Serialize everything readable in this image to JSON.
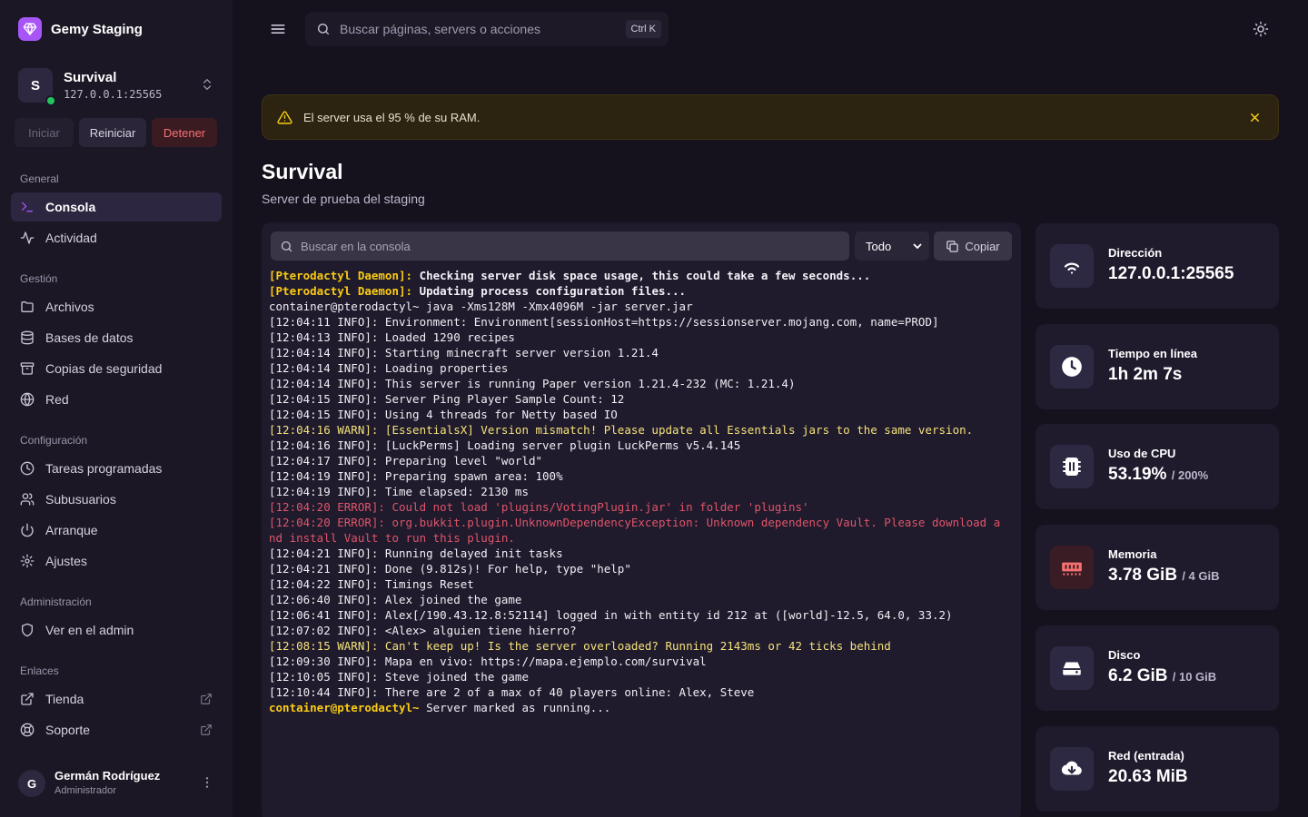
{
  "brand": {
    "name": "Gemy Staging"
  },
  "server": {
    "initial": "S",
    "name": "Survival",
    "address": "127.0.0.1:25565"
  },
  "power": {
    "start": "Iniciar",
    "restart": "Reiniciar",
    "stop": "Detener"
  },
  "nav": {
    "general": {
      "title": "General",
      "items": [
        "Consola",
        "Actividad"
      ]
    },
    "management": {
      "title": "Gestión",
      "items": [
        "Archivos",
        "Bases de datos",
        "Copias de seguridad",
        "Red"
      ]
    },
    "config": {
      "title": "Configuración",
      "items": [
        "Tareas programadas",
        "Subusuarios",
        "Arranque",
        "Ajustes"
      ]
    },
    "admin": {
      "title": "Administración",
      "items": [
        "Ver en el admin"
      ]
    },
    "links": {
      "title": "Enlaces",
      "items": [
        "Tienda",
        "Soporte"
      ]
    }
  },
  "user": {
    "initial": "G",
    "name": "Germán Rodríguez",
    "role": "Administrador"
  },
  "topbar": {
    "search_placeholder": "Buscar páginas, servers o acciones",
    "shortcut": "Ctrl K"
  },
  "alert": {
    "message": "El server usa el 95 % de su RAM."
  },
  "page": {
    "title": "Survival",
    "subtitle": "Server de prueba del staging"
  },
  "console": {
    "search_placeholder": "Buscar en la consola",
    "filter": "Todo",
    "copy": "Copiar",
    "lines": [
      {
        "t": "daemon",
        "a": "[Pterodactyl Daemon]:",
        "b": " Checking server disk space usage, this could take a few seconds..."
      },
      {
        "t": "daemon",
        "a": "[Pterodactyl Daemon]:",
        "b": " Updating process configuration files..."
      },
      {
        "t": "info",
        "text": "container@pterodactyl~ java -Xms128M -Xmx4096M -jar server.jar"
      },
      {
        "t": "info",
        "text": "[12:04:11 INFO]: Environment: Environment[sessionHost=https://sessionserver.mojang.com, name=PROD]"
      },
      {
        "t": "info",
        "text": "[12:04:13 INFO]: Loaded 1290 recipes"
      },
      {
        "t": "info",
        "text": "[12:04:14 INFO]: Starting minecraft server version 1.21.4"
      },
      {
        "t": "info",
        "text": "[12:04:14 INFO]: Loading properties"
      },
      {
        "t": "info",
        "text": "[12:04:14 INFO]: This server is running Paper version 1.21.4-232 (MC: 1.21.4)"
      },
      {
        "t": "info",
        "text": "[12:04:15 INFO]: Server Ping Player Sample Count: 12"
      },
      {
        "t": "info",
        "text": "[12:04:15 INFO]: Using 4 threads for Netty based IO"
      },
      {
        "t": "warn",
        "text": "[12:04:16 WARN]: [EssentialsX] Version mismatch! Please update all Essentials jars to the same version."
      },
      {
        "t": "info",
        "text": "[12:04:16 INFO]: [LuckPerms] Loading server plugin LuckPerms v5.4.145"
      },
      {
        "t": "info",
        "text": "[12:04:17 INFO]: Preparing level \"world\""
      },
      {
        "t": "info",
        "text": "[12:04:19 INFO]: Preparing spawn area: 100%"
      },
      {
        "t": "info",
        "text": "[12:04:19 INFO]: Time elapsed: 2130 ms"
      },
      {
        "t": "error",
        "text": "[12:04:20 ERROR]: Could not load 'plugins/VotingPlugin.jar' in folder 'plugins'"
      },
      {
        "t": "error",
        "text": "[12:04:20 ERROR]: org.bukkit.plugin.UnknownDependencyException: Unknown dependency Vault. Please download and install Vault to run this plugin."
      },
      {
        "t": "info",
        "text": "[12:04:21 INFO]: Running delayed init tasks"
      },
      {
        "t": "info",
        "text": "[12:04:21 INFO]: Done (9.812s)! For help, type \"help\""
      },
      {
        "t": "info",
        "text": "[12:04:22 INFO]: Timings Reset"
      },
      {
        "t": "info",
        "text": "[12:06:40 INFO]: Alex joined the game"
      },
      {
        "t": "info",
        "text": "[12:06:41 INFO]: Alex[/190.43.12.8:52114] logged in with entity id 212 at ([world]-12.5, 64.0, 33.2)"
      },
      {
        "t": "info",
        "text": "[12:07:02 INFO]: <Alex> alguien tiene hierro?"
      },
      {
        "t": "warn",
        "text": "[12:08:15 WARN]: Can't keep up! Is the server overloaded? Running 2143ms or 42 ticks behind"
      },
      {
        "t": "info",
        "text": "[12:09:30 INFO]: Mapa en vivo: https://mapa.ejemplo.com/survival"
      },
      {
        "t": "info",
        "text": "[12:10:05 INFO]: Steve joined the game"
      },
      {
        "t": "info",
        "text": "[12:10:44 INFO]: There are 2 of a max of 40 players online: Alex, Steve"
      },
      {
        "t": "prompt",
        "a": "container@pterodactyl~",
        "b": " Server marked as running..."
      }
    ]
  },
  "stats": [
    {
      "icon": "wifi-icon",
      "label": "Dirección",
      "value": "127.0.0.1:25565",
      "max": ""
    },
    {
      "icon": "clock-icon",
      "label": "Tiempo en línea",
      "value": "1h 2m 7s",
      "max": ""
    },
    {
      "icon": "cpu-icon",
      "label": "Uso de CPU",
      "value": "53.19%",
      "max": "/ 200%"
    },
    {
      "icon": "memory-icon",
      "label": "Memoria",
      "value": "3.78 GiB",
      "max": "/ 4 GiB"
    },
    {
      "icon": "disk-icon",
      "label": "Disco",
      "value": "6.2 GiB",
      "max": "/ 10 GiB"
    },
    {
      "icon": "download-icon",
      "label": "Red (entrada)",
      "value": "20.63 MiB",
      "max": ""
    }
  ],
  "colors": {
    "accent": "#a855f7",
    "online": "#22c55e",
    "warn": "#facc15",
    "error": "#e0556a",
    "memory": "#f87171"
  }
}
